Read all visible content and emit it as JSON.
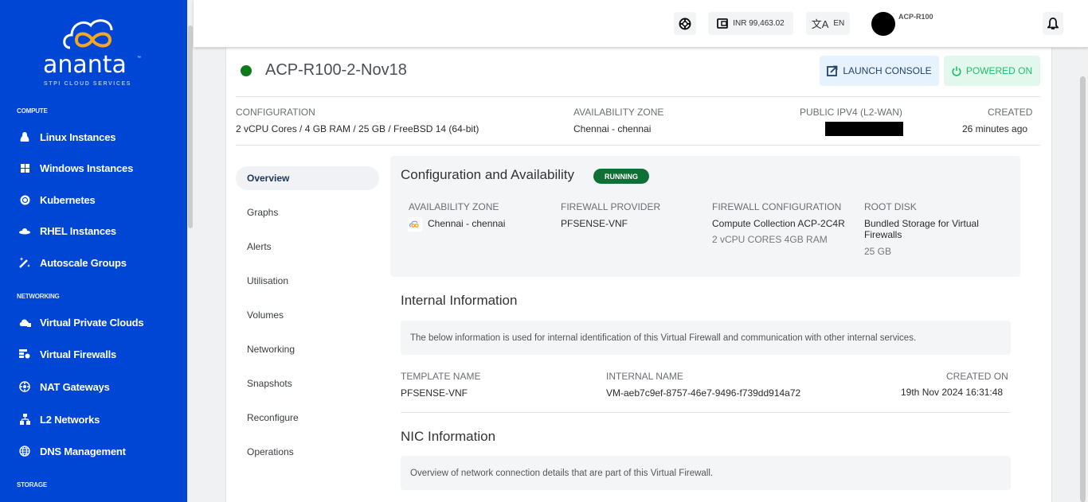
{
  "brand": {
    "name": "ananta",
    "trademark": "™",
    "tagline": "STPI CLOUD SERVICES"
  },
  "sidebar": {
    "sections": [
      {
        "label": "COMPUTE",
        "items": [
          {
            "label": "Linux Instances",
            "icon": "linux-icon"
          },
          {
            "label": "Windows Instances",
            "icon": "windows-icon"
          },
          {
            "label": "Kubernetes",
            "icon": "kubernetes-icon"
          },
          {
            "label": "RHEL Instances",
            "icon": "redhat-icon"
          },
          {
            "label": "Autoscale Groups",
            "icon": "magic-wand-icon"
          }
        ]
      },
      {
        "label": "NETWORKING",
        "items": [
          {
            "label": "Virtual Private Clouds",
            "icon": "cloud-lock-icon"
          },
          {
            "label": "Virtual Firewalls",
            "icon": "firewall-icon"
          },
          {
            "label": "NAT Gateways",
            "icon": "nat-gateway-icon"
          },
          {
            "label": "L2 Networks",
            "icon": "network-tree-icon"
          },
          {
            "label": "DNS Management",
            "icon": "globe-icon"
          }
        ]
      },
      {
        "label": "STORAGE",
        "items": []
      }
    ]
  },
  "header": {
    "support_icon": "lifebuoy-icon",
    "balance": "INR 99,463.02",
    "language": "EN",
    "user": "ACP-R100",
    "notification_icon": "bell-icon"
  },
  "instance": {
    "name": "ACP-R100-2-Nov18",
    "status_color": "#0f7a1a",
    "launch_console_label": "LAUNCH CONSOLE",
    "power_label": "POWERED ON",
    "summary": {
      "configuration_label": "CONFIGURATION",
      "configuration_value": "2 vCPU Cores / 4 GB RAM / 25 GB / FreeBSD 14 (64-bit)",
      "zone_label": "AVAILABILITY ZONE",
      "zone_value": "Chennai - chennai",
      "public_ip_label": "PUBLIC IPV4 (L2-WAN)",
      "public_ip_value": "[redacted]",
      "created_label": "CREATED",
      "created_value": "26 minutes ago"
    }
  },
  "tabs": [
    {
      "label": "Overview",
      "active": true
    },
    {
      "label": "Graphs"
    },
    {
      "label": "Alerts"
    },
    {
      "label": "Utilisation"
    },
    {
      "label": "Volumes"
    },
    {
      "label": "Networking"
    },
    {
      "label": "Snapshots"
    },
    {
      "label": "Reconfigure"
    },
    {
      "label": "Operations"
    }
  ],
  "config_availability": {
    "title": "Configuration and Availability",
    "status_badge": "RUNNING",
    "zone_label": "AVAILABILITY ZONE",
    "zone_value": "Chennai - chennai",
    "provider_label": "FIREWALL PROVIDER",
    "provider_value": "PFSENSE-VNF",
    "fw_config_label": "FIREWALL CONFIGURATION",
    "fw_config_value": "Compute Collection ACP-2C4R",
    "fw_config_sub": "2 vCPU CORES 4GB RAM",
    "root_disk_label": "ROOT DISK",
    "root_disk_value": "Bundled Storage for Virtual Firewalls",
    "root_disk_sub": "25 GB"
  },
  "internal_info": {
    "title": "Internal Information",
    "description": "The below information is used for internal identification of this Virtual Firewall and communication with other internal services.",
    "template_label": "TEMPLATE NAME",
    "template_value": "PFSENSE-VNF",
    "internal_name_label": "INTERNAL NAME",
    "internal_name_value": "VM-aeb7c9ef-8757-46e7-9496-f739dd914a72",
    "created_on_label": "CREATED ON",
    "created_on_value": "19th Nov 2024 16:31:48"
  },
  "nic_info": {
    "title": "NIC Information",
    "description": "Overview of network connection details that are part of this Virtual Firewall."
  }
}
